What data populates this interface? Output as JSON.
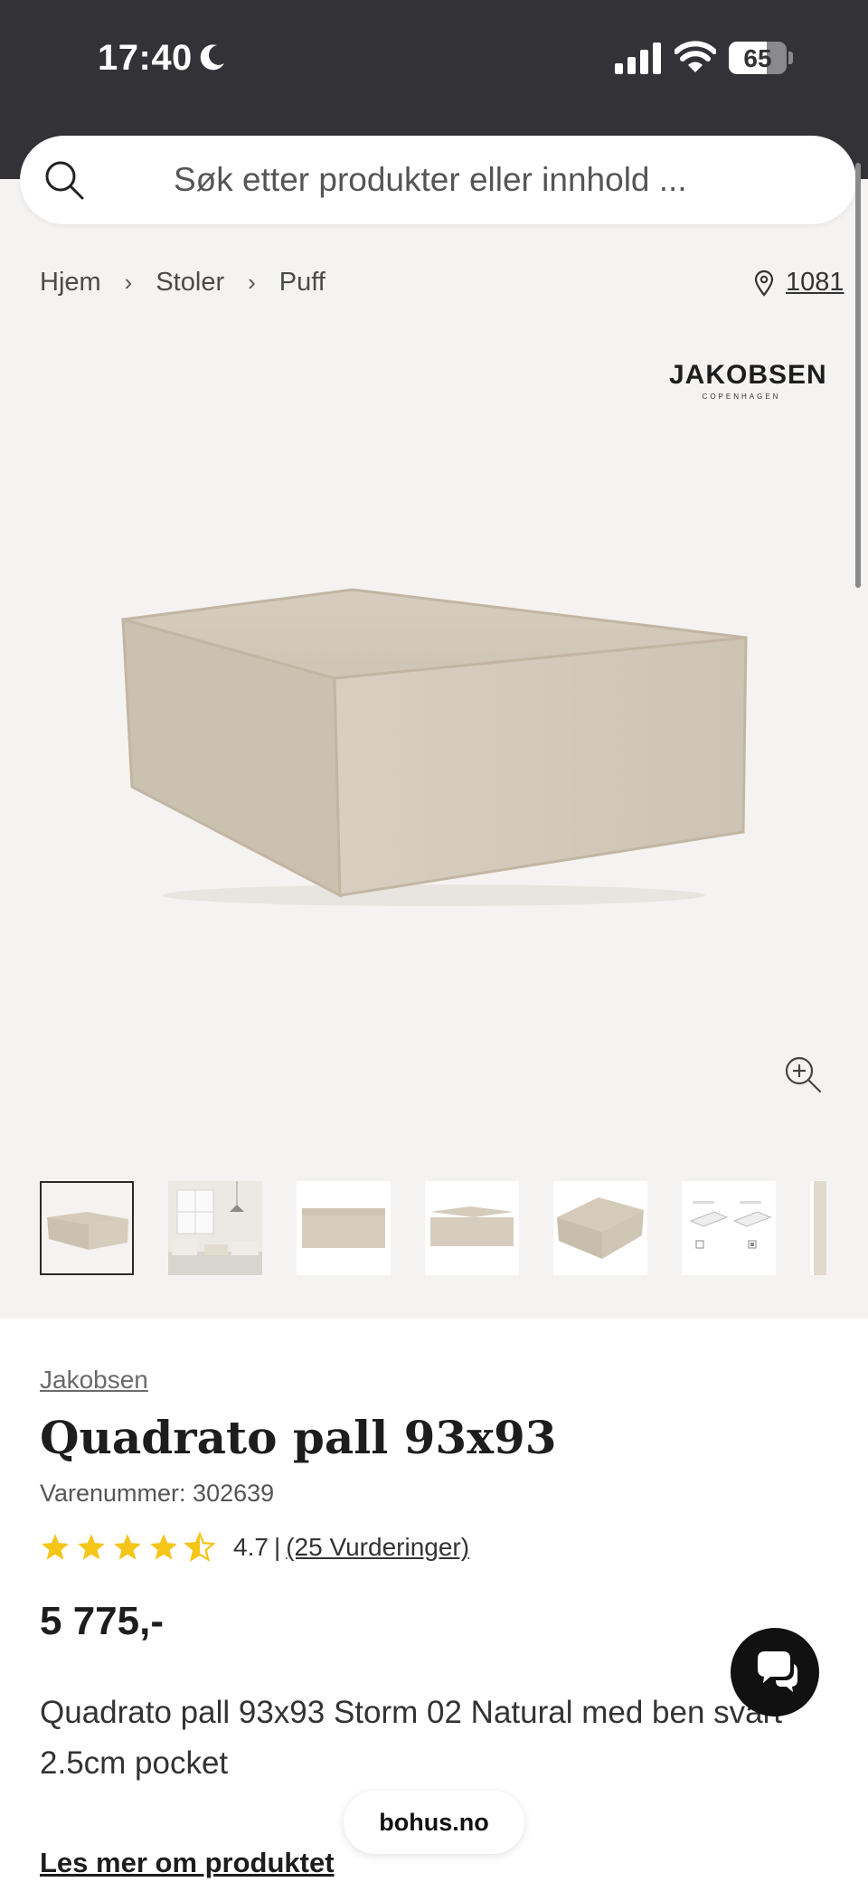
{
  "status_bar": {
    "time": "17:40",
    "battery": "65",
    "battery_level_percent": 65
  },
  "search": {
    "placeholder": "Søk etter produkter eller innhold ..."
  },
  "breadcrumb": {
    "items": [
      "Hjem",
      "Stoler",
      "Puff"
    ]
  },
  "store": {
    "label": "1081"
  },
  "brand_logo": {
    "main": "JAKOBSEN",
    "sub": "COPENHAGEN"
  },
  "thumbnails": {
    "count": 7,
    "selected_index": 0
  },
  "product": {
    "brand": "Jakobsen",
    "title": "Quadrato pall 93x93",
    "sku": "Varenummer: 302639",
    "rating_value": "4.7",
    "rating_separator": "|",
    "rating_count": "(25 Vurderinger)",
    "stars": 4.7,
    "price": "5 775,-",
    "description": "Quadrato pall 93x93 Storm 02 Natural med ben svart 2.5cm pocket",
    "read_more": "Les mer om produktet"
  },
  "browser": {
    "domain": "bohus.no"
  },
  "colors": {
    "status_bar": "#333337",
    "star": "#f5c518",
    "page_bg": "#f5f3f1",
    "fabric": "#d9d1c4"
  }
}
